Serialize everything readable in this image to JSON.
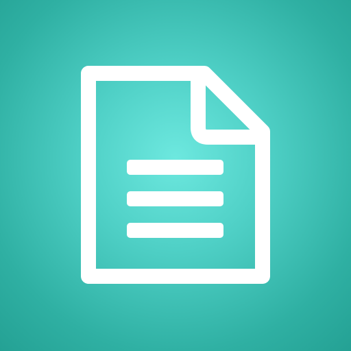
{
  "icon": {
    "name": "document-icon",
    "color": "#ffffff"
  },
  "background": {
    "center_color": "#6de8df",
    "edge_color": "#24a194"
  }
}
